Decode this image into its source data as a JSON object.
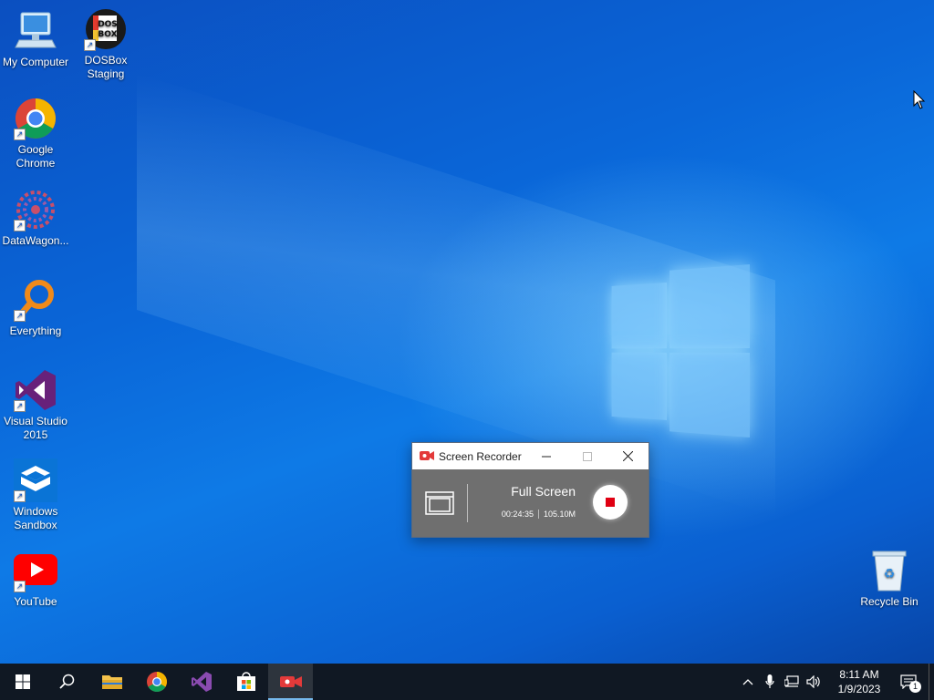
{
  "desktop": {
    "icons": [
      {
        "label_line1": "My Computer",
        "label_line2": ""
      },
      {
        "label_line1": "DOSBox",
        "label_line2": "Staging",
        "badge": "DOS BOX"
      },
      {
        "label_line1": "Google",
        "label_line2": "Chrome"
      },
      {
        "label_line1": "DataWagon...",
        "label_line2": ""
      },
      {
        "label_line1": "Everything",
        "label_line2": ""
      },
      {
        "label_line1": "Visual Studio",
        "label_line2": "2015"
      },
      {
        "label_line1": "Windows",
        "label_line2": "Sandbox"
      },
      {
        "label_line1": "YouTube",
        "label_line2": ""
      },
      {
        "label_line1": "Recycle Bin",
        "label_line2": ""
      }
    ]
  },
  "recorder": {
    "title": "Screen Recorder",
    "mode": "Full Screen",
    "elapsed": "00:24:35",
    "size": "105.10M",
    "record_color": "#e00012"
  },
  "taskbar": {
    "time": "8:11 AM",
    "date": "1/9/2023",
    "notification_count": "1"
  },
  "colors": {
    "taskbar_bg": "#101823",
    "accent": "#76b9ed"
  }
}
